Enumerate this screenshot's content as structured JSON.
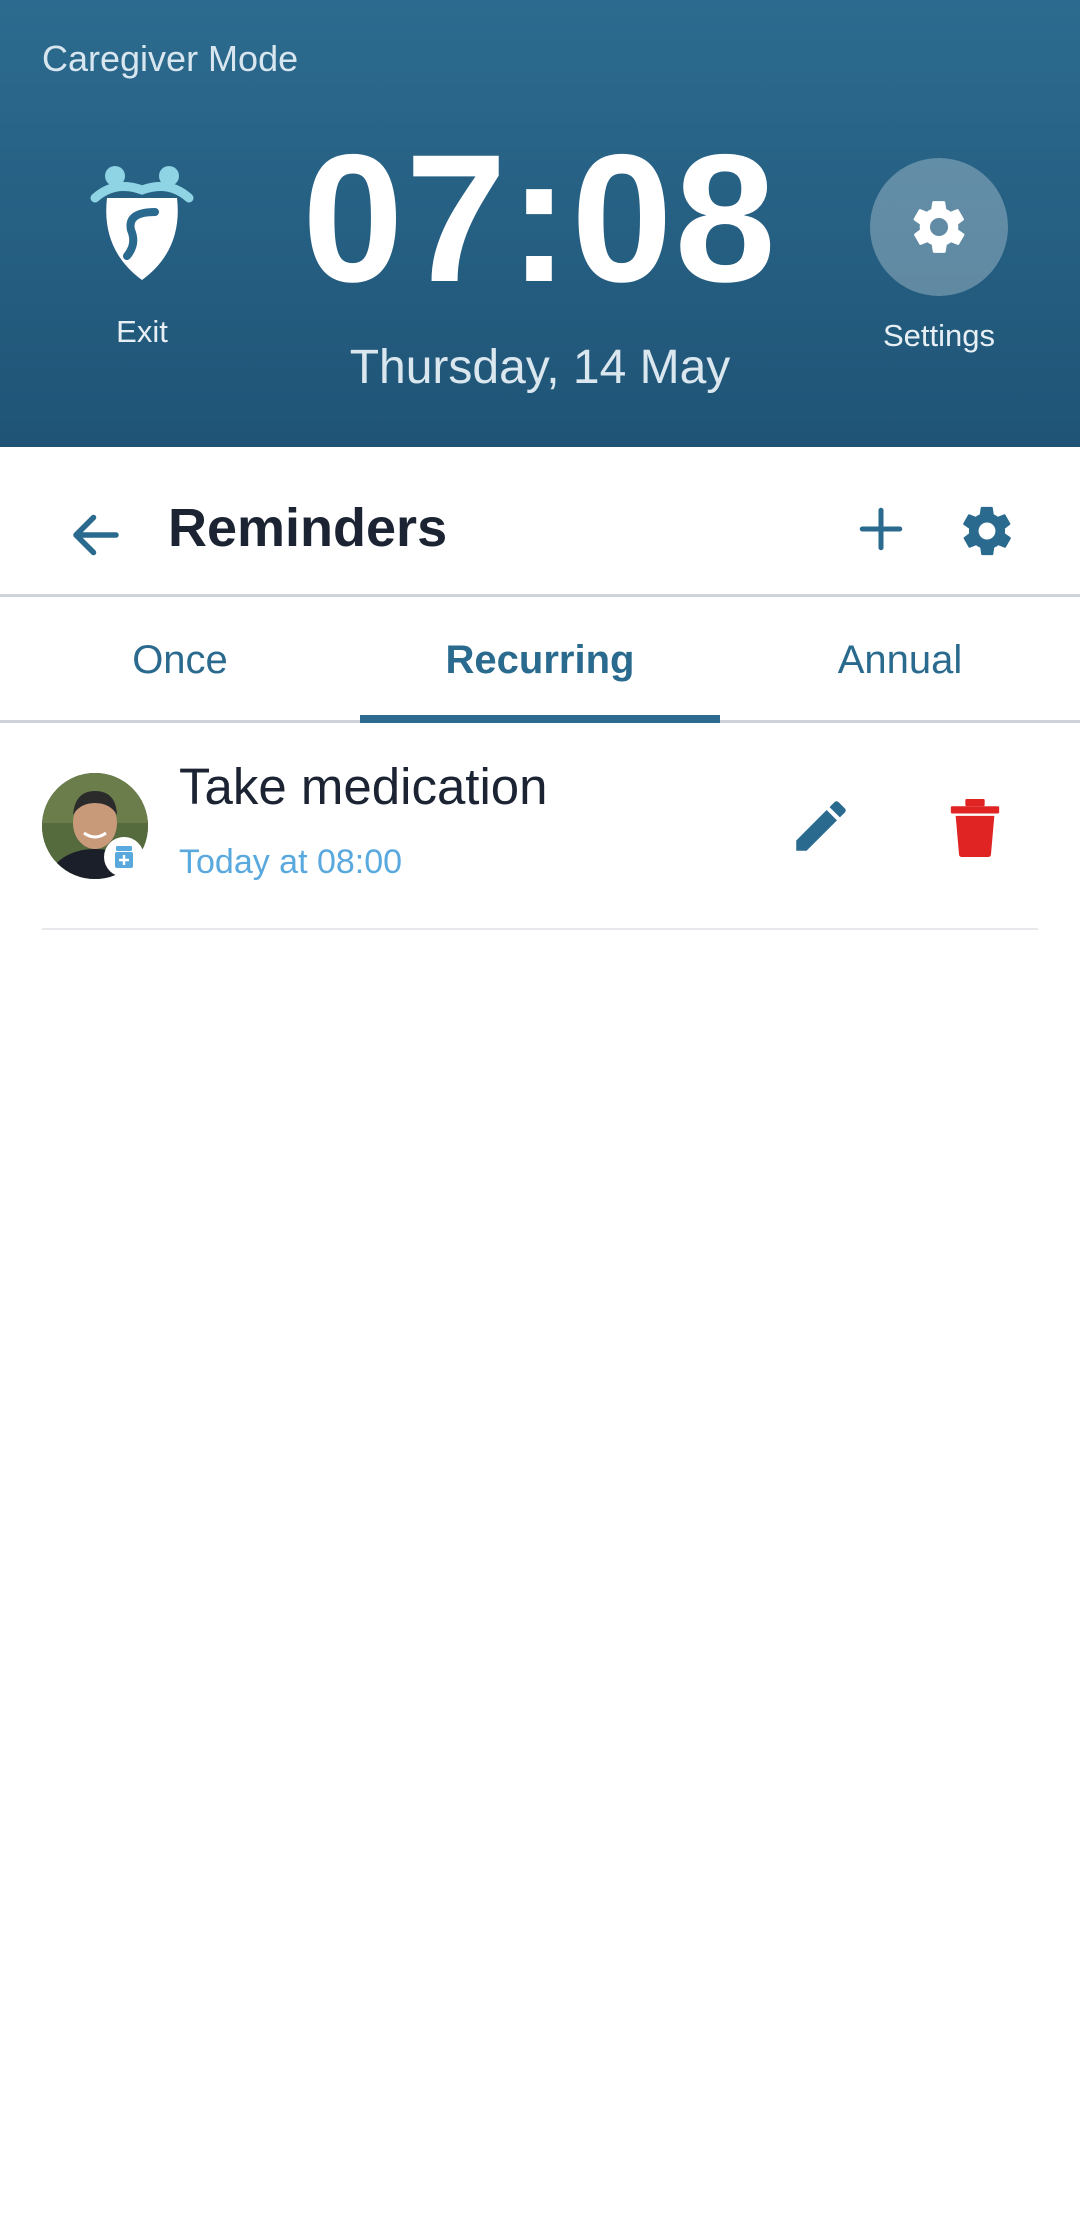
{
  "header": {
    "mode_title": "Caregiver Mode",
    "exit_label": "Exit",
    "time": "07:08",
    "date": "Thursday, 14 May",
    "settings_label": "Settings"
  },
  "toolbar": {
    "title": "Reminders"
  },
  "tabs": [
    {
      "label": "Once",
      "active": false
    },
    {
      "label": "Recurring",
      "active": true
    },
    {
      "label": "Annual",
      "active": false
    }
  ],
  "reminders": [
    {
      "title": "Take medication",
      "schedule": "Today at 08:00"
    }
  ],
  "colors": {
    "header_bg": "#2c6b8f",
    "accent": "#2a6a8e",
    "schedule_text": "#5aa9de",
    "delete": "#e02424"
  }
}
